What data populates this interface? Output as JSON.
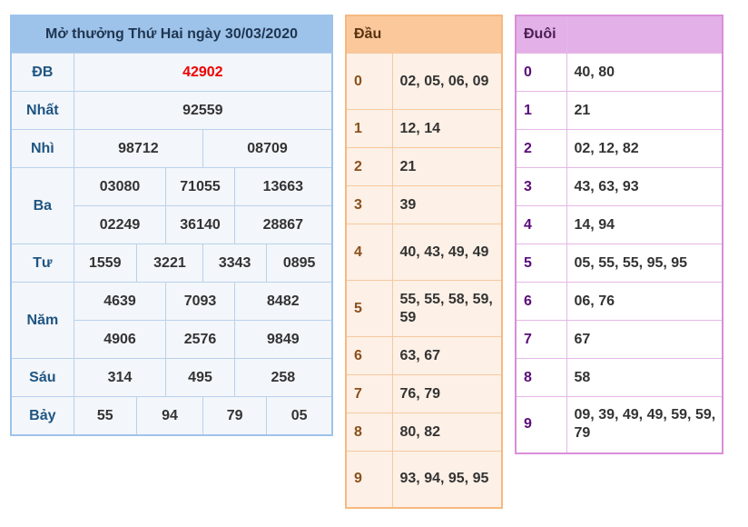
{
  "results": {
    "title": "Mở thưởng Thứ Hai ngày 30/03/2020",
    "db": {
      "label": "ĐB",
      "value": "42902"
    },
    "nhat": {
      "label": "Nhất",
      "value": "92559"
    },
    "nhi": {
      "label": "Nhì",
      "values": [
        "98712",
        "08709"
      ]
    },
    "ba": {
      "label": "Ba",
      "values": [
        "03080",
        "71055",
        "13663",
        "02249",
        "36140",
        "28867"
      ]
    },
    "tu": {
      "label": "Tư",
      "values": [
        "1559",
        "3221",
        "3343",
        "0895"
      ]
    },
    "nam": {
      "label": "Năm",
      "values": [
        "4639",
        "7093",
        "8482",
        "4906",
        "2576",
        "9849"
      ]
    },
    "sau": {
      "label": "Sáu",
      "values": [
        "314",
        "495",
        "258"
      ]
    },
    "bay": {
      "label": "Bảy",
      "values": [
        "55",
        "94",
        "79",
        "05"
      ]
    }
  },
  "dau": {
    "header": "Đầu",
    "rows": [
      {
        "key": "0",
        "value": "02, 05, 06, 09"
      },
      {
        "key": "1",
        "value": "12, 14"
      },
      {
        "key": "2",
        "value": "21"
      },
      {
        "key": "3",
        "value": "39"
      },
      {
        "key": "4",
        "value": "40, 43, 49, 49"
      },
      {
        "key": "5",
        "value": "55, 55, 58, 59, 59"
      },
      {
        "key": "6",
        "value": "63, 67"
      },
      {
        "key": "7",
        "value": "76, 79"
      },
      {
        "key": "8",
        "value": "80, 82"
      },
      {
        "key": "9",
        "value": "93, 94, 95, 95"
      }
    ]
  },
  "duoi": {
    "header": "Đuôi",
    "rows": [
      {
        "key": "0",
        "value": "40, 80"
      },
      {
        "key": "1",
        "value": "21"
      },
      {
        "key": "2",
        "value": "02, 12, 82"
      },
      {
        "key": "3",
        "value": "43, 63, 93"
      },
      {
        "key": "4",
        "value": "14, 94"
      },
      {
        "key": "5",
        "value": "05, 55, 55, 95, 95"
      },
      {
        "key": "6",
        "value": "06, 76"
      },
      {
        "key": "7",
        "value": "67"
      },
      {
        "key": "8",
        "value": "58"
      },
      {
        "key": "9",
        "value": "09, 39, 49, 49, 59, 59, 79"
      }
    ]
  }
}
